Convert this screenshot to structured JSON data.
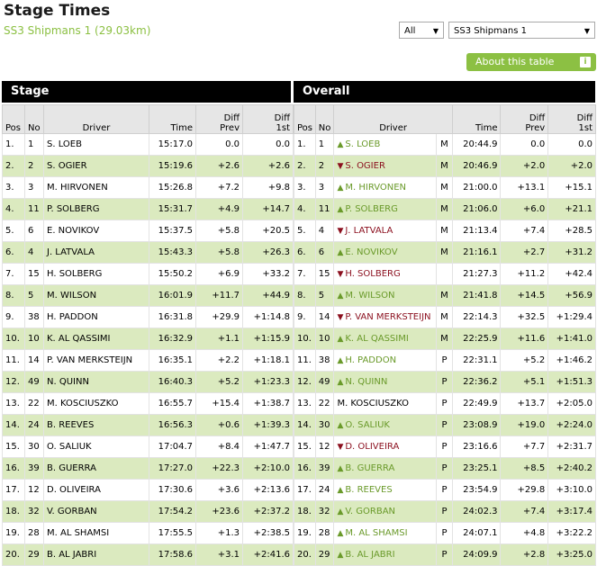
{
  "header": {
    "title": "Stage Times",
    "subtitle": "SS3 Shipmans 1 (29.03km)"
  },
  "filters": {
    "group": "All",
    "stage": "SS3 Shipmans 1"
  },
  "about_button": {
    "label": "About this table",
    "icon": "i"
  },
  "sections": {
    "stage": "Stage",
    "overall": "Overall"
  },
  "columns": {
    "pos": "Pos",
    "no": "No",
    "driver": "Driver",
    "time": "Time",
    "diff_prev": [
      "Diff",
      "Prev"
    ],
    "diff_1st": [
      "Diff",
      "1st"
    ]
  },
  "colors": {
    "accent": "#8cc043",
    "row_alt": "#dbeabf",
    "up": "#6a9a2a",
    "down": "#8b0f1e"
  },
  "stage_rows": [
    {
      "pos": "1.",
      "no": "1",
      "driver": "S. LOEB",
      "time": "15:17.0",
      "prev": "0.0",
      "first": "0.0"
    },
    {
      "pos": "2.",
      "no": "2",
      "driver": "S. OGIER",
      "time": "15:19.6",
      "prev": "+2.6",
      "first": "+2.6"
    },
    {
      "pos": "3.",
      "no": "3",
      "driver": "M. HIRVONEN",
      "time": "15:26.8",
      "prev": "+7.2",
      "first": "+9.8"
    },
    {
      "pos": "4.",
      "no": "11",
      "driver": "P. SOLBERG",
      "time": "15:31.7",
      "prev": "+4.9",
      "first": "+14.7"
    },
    {
      "pos": "5.",
      "no": "6",
      "driver": "E. NOVIKOV",
      "time": "15:37.5",
      "prev": "+5.8",
      "first": "+20.5"
    },
    {
      "pos": "6.",
      "no": "4",
      "driver": "J. LATVALA",
      "time": "15:43.3",
      "prev": "+5.8",
      "first": "+26.3"
    },
    {
      "pos": "7.",
      "no": "15",
      "driver": "H. SOLBERG",
      "time": "15:50.2",
      "prev": "+6.9",
      "first": "+33.2"
    },
    {
      "pos": "8.",
      "no": "5",
      "driver": "M. WILSON",
      "time": "16:01.9",
      "prev": "+11.7",
      "first": "+44.9"
    },
    {
      "pos": "9.",
      "no": "38",
      "driver": "H. PADDON",
      "time": "16:31.8",
      "prev": "+29.9",
      "first": "+1:14.8"
    },
    {
      "pos": "10.",
      "no": "10",
      "driver": "K. AL QASSIMI",
      "time": "16:32.9",
      "prev": "+1.1",
      "first": "+1:15.9"
    },
    {
      "pos": "11.",
      "no": "14",
      "driver": "P. VAN MERKSTEIJN",
      "time": "16:35.1",
      "prev": "+2.2",
      "first": "+1:18.1"
    },
    {
      "pos": "12.",
      "no": "49",
      "driver": "N. QUINN",
      "time": "16:40.3",
      "prev": "+5.2",
      "first": "+1:23.3"
    },
    {
      "pos": "13.",
      "no": "22",
      "driver": "M. KOSCIUSZKO",
      "time": "16:55.7",
      "prev": "+15.4",
      "first": "+1:38.7"
    },
    {
      "pos": "14.",
      "no": "24",
      "driver": "B. REEVES",
      "time": "16:56.3",
      "prev": "+0.6",
      "first": "+1:39.3"
    },
    {
      "pos": "15.",
      "no": "30",
      "driver": "O. SALIUK",
      "time": "17:04.7",
      "prev": "+8.4",
      "first": "+1:47.7"
    },
    {
      "pos": "16.",
      "no": "39",
      "driver": "B. GUERRA",
      "time": "17:27.0",
      "prev": "+22.3",
      "first": "+2:10.0"
    },
    {
      "pos": "17.",
      "no": "12",
      "driver": "D. OLIVEIRA",
      "time": "17:30.6",
      "prev": "+3.6",
      "first": "+2:13.6"
    },
    {
      "pos": "18.",
      "no": "32",
      "driver": "V. GORBAN",
      "time": "17:54.2",
      "prev": "+23.6",
      "first": "+2:37.2"
    },
    {
      "pos": "19.",
      "no": "28",
      "driver": "M. AL SHAMSI",
      "time": "17:55.5",
      "prev": "+1.3",
      "first": "+2:38.5"
    },
    {
      "pos": "20.",
      "no": "29",
      "driver": "B. AL JABRI",
      "time": "17:58.6",
      "prev": "+3.1",
      "first": "+2:41.6"
    }
  ],
  "overall_rows": [
    {
      "pos": "1.",
      "no": "1",
      "trend": "up",
      "driver": "S. LOEB",
      "cls": "M",
      "time": "20:44.9",
      "prev": "0.0",
      "first": "0.0"
    },
    {
      "pos": "2.",
      "no": "2",
      "trend": "down",
      "driver": "S. OGIER",
      "cls": "M",
      "time": "20:46.9",
      "prev": "+2.0",
      "first": "+2.0"
    },
    {
      "pos": "3.",
      "no": "3",
      "trend": "up",
      "driver": "M. HIRVONEN",
      "cls": "M",
      "time": "21:00.0",
      "prev": "+13.1",
      "first": "+15.1"
    },
    {
      "pos": "4.",
      "no": "11",
      "trend": "up",
      "driver": "P. SOLBERG",
      "cls": "M",
      "time": "21:06.0",
      "prev": "+6.0",
      "first": "+21.1"
    },
    {
      "pos": "5.",
      "no": "4",
      "trend": "down",
      "driver": "J. LATVALA",
      "cls": "M",
      "time": "21:13.4",
      "prev": "+7.4",
      "first": "+28.5"
    },
    {
      "pos": "6.",
      "no": "6",
      "trend": "up",
      "driver": "E. NOVIKOV",
      "cls": "M",
      "time": "21:16.1",
      "prev": "+2.7",
      "first": "+31.2"
    },
    {
      "pos": "7.",
      "no": "15",
      "trend": "down",
      "driver": "H. SOLBERG",
      "cls": "",
      "time": "21:27.3",
      "prev": "+11.2",
      "first": "+42.4"
    },
    {
      "pos": "8.",
      "no": "5",
      "trend": "up",
      "driver": "M. WILSON",
      "cls": "M",
      "time": "21:41.8",
      "prev": "+14.5",
      "first": "+56.9"
    },
    {
      "pos": "9.",
      "no": "14",
      "trend": "down",
      "driver": "P. VAN MERKSTEIJN",
      "cls": "M",
      "time": "22:14.3",
      "prev": "+32.5",
      "first": "+1:29.4"
    },
    {
      "pos": "10.",
      "no": "10",
      "trend": "up",
      "driver": "K. AL QASSIMI",
      "cls": "M",
      "time": "22:25.9",
      "prev": "+11.6",
      "first": "+1:41.0"
    },
    {
      "pos": "11.",
      "no": "38",
      "trend": "up",
      "driver": "H. PADDON",
      "cls": "P",
      "time": "22:31.1",
      "prev": "+5.2",
      "first": "+1:46.2"
    },
    {
      "pos": "12.",
      "no": "49",
      "trend": "up",
      "driver": "N. QUINN",
      "cls": "P",
      "time": "22:36.2",
      "prev": "+5.1",
      "first": "+1:51.3"
    },
    {
      "pos": "13.",
      "no": "22",
      "trend": "",
      "driver": "M. KOSCIUSZKO",
      "cls": "P",
      "time": "22:49.9",
      "prev": "+13.7",
      "first": "+2:05.0"
    },
    {
      "pos": "14.",
      "no": "30",
      "trend": "up",
      "driver": "O. SALIUK",
      "cls": "P",
      "time": "23:08.9",
      "prev": "+19.0",
      "first": "+2:24.0"
    },
    {
      "pos": "15.",
      "no": "12",
      "trend": "down",
      "driver": "D. OLIVEIRA",
      "cls": "P",
      "time": "23:16.6",
      "prev": "+7.7",
      "first": "+2:31.7"
    },
    {
      "pos": "16.",
      "no": "39",
      "trend": "up",
      "driver": "B. GUERRA",
      "cls": "P",
      "time": "23:25.1",
      "prev": "+8.5",
      "first": "+2:40.2"
    },
    {
      "pos": "17.",
      "no": "24",
      "trend": "up",
      "driver": "B. REEVES",
      "cls": "P",
      "time": "23:54.9",
      "prev": "+29.8",
      "first": "+3:10.0"
    },
    {
      "pos": "18.",
      "no": "32",
      "trend": "up",
      "driver": "V. GORBAN",
      "cls": "P",
      "time": "24:02.3",
      "prev": "+7.4",
      "first": "+3:17.4"
    },
    {
      "pos": "19.",
      "no": "28",
      "trend": "up",
      "driver": "M. AL SHAMSI",
      "cls": "P",
      "time": "24:07.1",
      "prev": "+4.8",
      "first": "+3:22.2"
    },
    {
      "pos": "20.",
      "no": "29",
      "trend": "up",
      "driver": "B. AL JABRI",
      "cls": "P",
      "time": "24:09.9",
      "prev": "+2.8",
      "first": "+3:25.0"
    }
  ]
}
